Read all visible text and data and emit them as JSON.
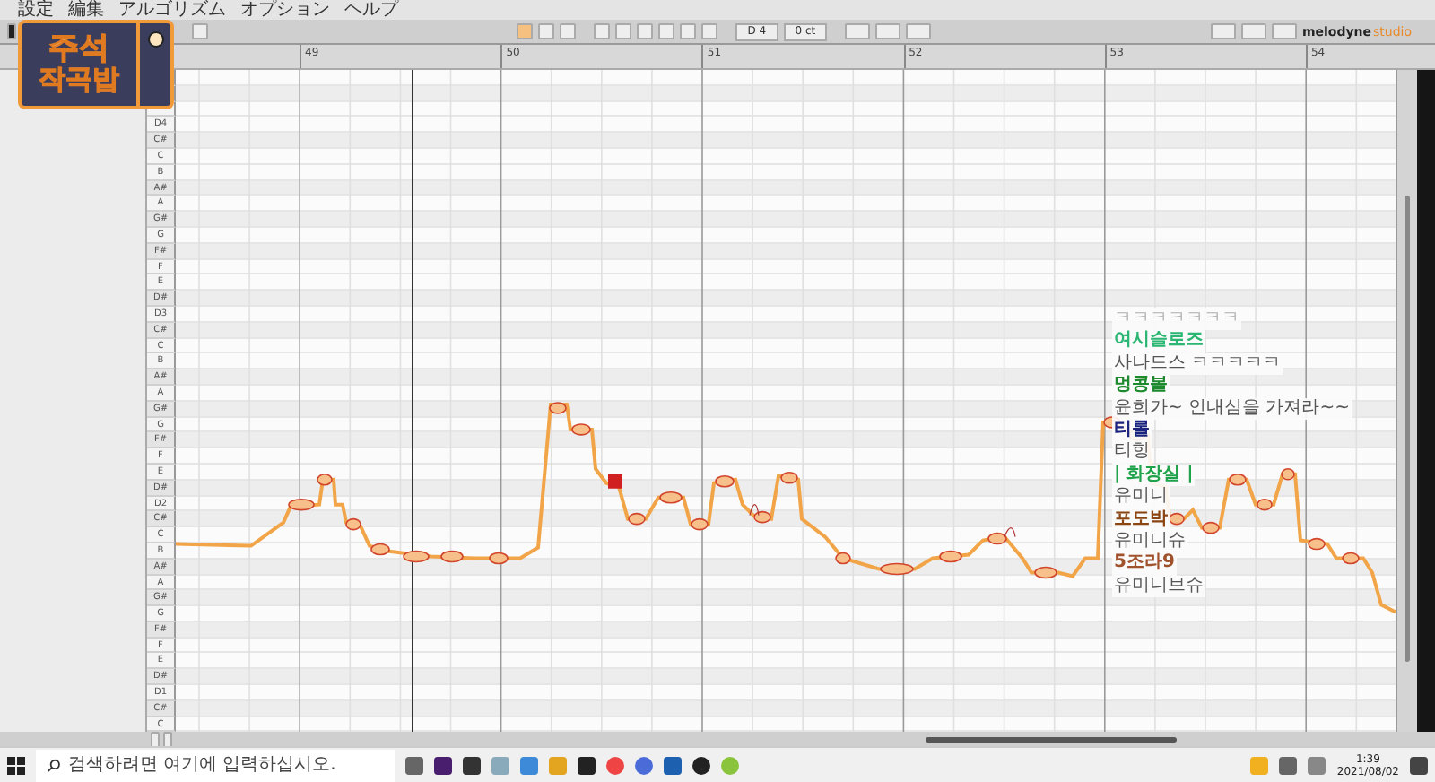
{
  "menu": [
    "設定",
    "編集",
    "アルゴリズム",
    "オプション",
    "ヘルプ"
  ],
  "logo": {
    "line_1": "주석",
    "line_2": "작곡밥"
  },
  "toolbar": {
    "pitch": "D 4",
    "cents": "0 ct"
  },
  "brand": {
    "name": "melodyne",
    "edition": "studio"
  },
  "ruler": [
    "49",
    "50",
    "51",
    "52",
    "53",
    "54"
  ],
  "keys": [
    {
      "label": "D4",
      "sharp": false
    },
    {
      "label": "C#",
      "sharp": true
    },
    {
      "label": "C",
      "sharp": false
    },
    {
      "label": "B",
      "sharp": false
    },
    {
      "label": "A#",
      "sharp": true
    },
    {
      "label": "A",
      "sharp": false
    },
    {
      "label": "G#",
      "sharp": true
    },
    {
      "label": "G",
      "sharp": false
    },
    {
      "label": "F#",
      "sharp": true
    },
    {
      "label": "F",
      "sharp": false
    },
    {
      "label": "E",
      "sharp": false
    },
    {
      "label": "D#",
      "sharp": true
    },
    {
      "label": "D3",
      "sharp": false
    },
    {
      "label": "C#",
      "sharp": true
    },
    {
      "label": "C",
      "sharp": false
    },
    {
      "label": "B",
      "sharp": false
    },
    {
      "label": "A#",
      "sharp": true
    },
    {
      "label": "A",
      "sharp": false
    },
    {
      "label": "G#",
      "sharp": true
    },
    {
      "label": "G",
      "sharp": false
    },
    {
      "label": "F#",
      "sharp": true
    },
    {
      "label": "F",
      "sharp": false
    },
    {
      "label": "E",
      "sharp": false
    },
    {
      "label": "D#",
      "sharp": true
    },
    {
      "label": "D2",
      "sharp": false
    },
    {
      "label": "C#",
      "sharp": true
    },
    {
      "label": "C",
      "sharp": false
    },
    {
      "label": "B",
      "sharp": false
    },
    {
      "label": "A#",
      "sharp": true
    },
    {
      "label": "A",
      "sharp": false
    },
    {
      "label": "G#",
      "sharp": true
    },
    {
      "label": "G",
      "sharp": false
    },
    {
      "label": "F#",
      "sharp": true
    },
    {
      "label": "F",
      "sharp": false
    },
    {
      "label": "E",
      "sharp": false
    },
    {
      "label": "D#",
      "sharp": true
    },
    {
      "label": "D1",
      "sharp": false
    },
    {
      "label": "C#",
      "sharp": true
    },
    {
      "label": "C",
      "sharp": false
    }
  ],
  "chat": [
    {
      "kind": "message",
      "text": "ㅋㅋㅋㅋㅋㅋㅋ",
      "color": "#b0b0b0"
    },
    {
      "kind": "name",
      "text": "여시슬로즈",
      "color": "#2bb673"
    },
    {
      "kind": "message",
      "text": "사나드스 ㅋㅋㅋㅋㅋ",
      "color": "#555555"
    },
    {
      "kind": "name",
      "text": "멍콩볼",
      "color": "#1e8a2e"
    },
    {
      "kind": "message",
      "text": "윤희가~ 인내심을 가져라~~",
      "color": "#555555"
    },
    {
      "kind": "name",
      "text": "티롤",
      "color": "#1a237e"
    },
    {
      "kind": "message",
      "text": "티힝",
      "color": "#555555"
    },
    {
      "kind": "name",
      "text": "| 화장실 |",
      "color": "#1fa34a"
    },
    {
      "kind": "message",
      "text": "유미니",
      "color": "#555555"
    },
    {
      "kind": "name",
      "text": "포도박",
      "color": "#8b4513"
    },
    {
      "kind": "message",
      "text": "유미니슈",
      "color": "#555555"
    },
    {
      "kind": "name",
      "text": "5조라9",
      "color": "#a0522d"
    },
    {
      "kind": "message",
      "text": "유미니브슈",
      "color": "#555555"
    }
  ],
  "taskbar": {
    "search": {
      "placeholder": "검색하려면 여기에 입력하십시오."
    },
    "time": "1:39",
    "date": "2021/08/02"
  }
}
